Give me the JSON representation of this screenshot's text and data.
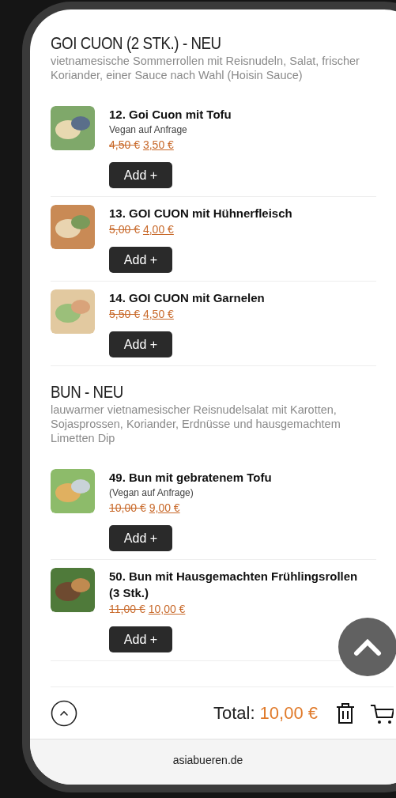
{
  "sections": [
    {
      "title": "GOI CUON (2 STK.) - NEU",
      "description": "vietnamesische Sommerrollen mit Reisnudeln, Salat, frischer Koriander, einer Sauce nach Wahl (Hoisin Sauce)",
      "items": [
        {
          "name": "12. Goi Cuon mit Tofu",
          "note": "Vegan auf Anfrage",
          "old_price": "4,50 €",
          "price": "3,50 €",
          "button": "Add +"
        },
        {
          "name": "13. GOI CUON mit Hühnerfleisch",
          "old_price": "5,00 €",
          "price": "4,00 €",
          "button": "Add +"
        },
        {
          "name": "14. GOI CUON mit Garnelen",
          "old_price": "5,50 €",
          "price": "4,50 €",
          "button": "Add +"
        }
      ]
    },
    {
      "title": "BUN - NEU",
      "description": "lauwarmer vietnamesischer Reisnudelsalat mit Karotten, Sojasprossen, Koriander, Erdnüsse und hausgemachtem Limetten Dip",
      "items": [
        {
          "name": "49. Bun mit gebratenem Tofu",
          "note": "(Vegan auf Anfrage)",
          "old_price": "10,00 €",
          "price": "9,00 €",
          "button": "Add +"
        },
        {
          "name": "50. Bun mit Hausgemachten Frühlingsrollen (3 Stk.)",
          "old_price": "11,00 €",
          "price": "10,00 €",
          "button": "Add +"
        }
      ]
    }
  ],
  "footer": {
    "total_label": "Total:",
    "total_value": "10,00 €"
  },
  "url": "asiabueren.de"
}
